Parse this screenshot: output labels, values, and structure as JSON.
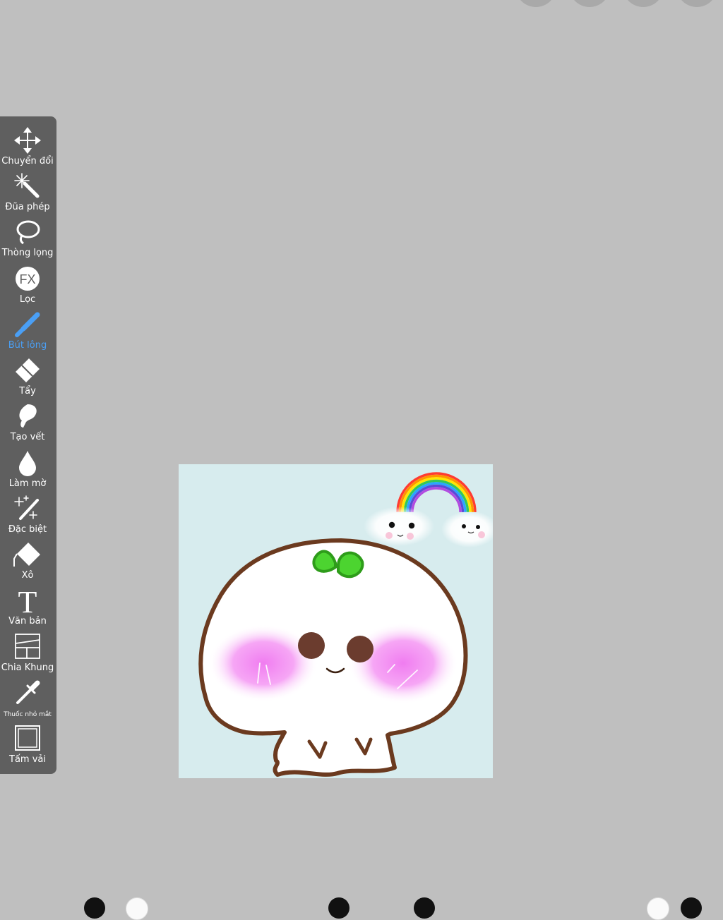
{
  "toolbar": {
    "active_color": "#4a9ff5",
    "tools": [
      {
        "label": "Chuyển đổi",
        "icon": "move-icon"
      },
      {
        "label": "Đũa phép",
        "icon": "magic-wand-icon"
      },
      {
        "label": "Thòng lọng",
        "icon": "lasso-icon"
      },
      {
        "label": "Lọc",
        "icon": "fx-filter-icon"
      },
      {
        "label": "Bút lông",
        "icon": "brush-icon",
        "active": true
      },
      {
        "label": "Tẩy",
        "icon": "eraser-icon"
      },
      {
        "label": "Tạo vết",
        "icon": "smudge-icon"
      },
      {
        "label": "Làm mờ",
        "icon": "blur-drop-icon"
      },
      {
        "label": "Đặc biệt",
        "icon": "special-wand-icon"
      },
      {
        "label": "Xô",
        "icon": "bucket-icon"
      },
      {
        "label": "Văn bản",
        "icon": "text-icon"
      },
      {
        "label": "Chia Khung",
        "icon": "frame-divider-icon"
      },
      {
        "label": "Thuốc nhỏ mắt",
        "icon": "eyedropper-icon"
      },
      {
        "label": "Tấm vải",
        "icon": "canvas-icon"
      }
    ]
  },
  "canvas": {
    "background_color": "#d7ecee",
    "outline_color": "#6b3a1f",
    "leaf_color": "#4cd430",
    "blush_color": "#f27ef0"
  }
}
